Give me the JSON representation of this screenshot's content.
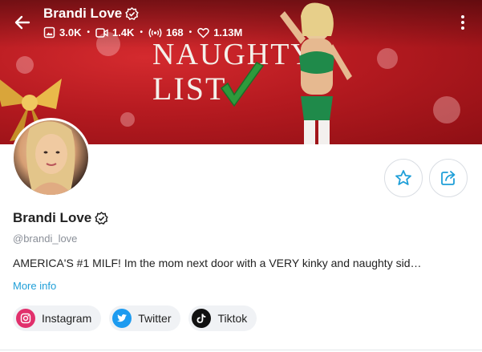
{
  "header": {
    "name": "Brandi Love",
    "stats": {
      "photos": "3.0K",
      "videos": "1.4K",
      "streams": "168",
      "likes": "1.13M"
    }
  },
  "banner": {
    "line1": "NAUGHTY",
    "line2": "LIST"
  },
  "profile": {
    "name": "Brandi Love",
    "handle": "@brandi_love",
    "bio": "AMERICA'S #1 MILF! Im the mom next door with a VERY kinky and naughty sid…",
    "more_info": "More info"
  },
  "socials": [
    {
      "label": "Instagram",
      "icon": "instagram-icon"
    },
    {
      "label": "Twitter",
      "icon": "twitter-icon"
    },
    {
      "label": "Tiktok",
      "icon": "tiktok-icon"
    }
  ],
  "colors": {
    "banner_red": "#c0161c",
    "accent_blue": "#1f9fd8",
    "chip_bg": "#f0f2f5"
  }
}
